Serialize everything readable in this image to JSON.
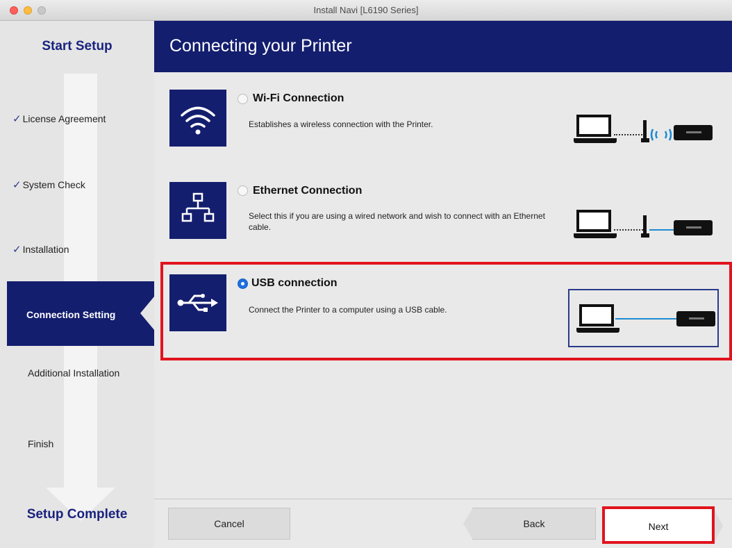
{
  "window": {
    "title": "Install Navi [L6190 Series]"
  },
  "sidebar": {
    "start_heading": "Start Setup",
    "end_heading": "Setup Complete",
    "check_mark": "✓",
    "steps": [
      {
        "label": "License Agreement",
        "state": "done"
      },
      {
        "label": "System Check",
        "state": "done"
      },
      {
        "label": "Installation",
        "state": "done"
      },
      {
        "label": "Connection Setting",
        "state": "active"
      },
      {
        "label": "Additional Installation",
        "state": "pending"
      },
      {
        "label": "Finish",
        "state": "pending"
      }
    ]
  },
  "main": {
    "title": "Connecting your Printer",
    "options": [
      {
        "title": "Wi-Fi Connection",
        "description": "Establishes a wireless connection with the Printer.",
        "icon": "wifi-icon",
        "selected": false
      },
      {
        "title": "Ethernet Connection",
        "description": "Select this if you are using a wired network and wish to connect with an Ethernet cable.",
        "icon": "ethernet-icon",
        "selected": false
      },
      {
        "title": "USB connection",
        "description": "Connect the Printer to a computer using a USB cable.",
        "icon": "usb-icon",
        "selected": true
      }
    ]
  },
  "footer": {
    "cancel_label": "Cancel",
    "back_label": "Back",
    "next_label": "Next"
  },
  "colors": {
    "brand_navy": "#141e6e",
    "highlight_red": "#e0141e",
    "radio_selected": "#1c6fe0"
  }
}
